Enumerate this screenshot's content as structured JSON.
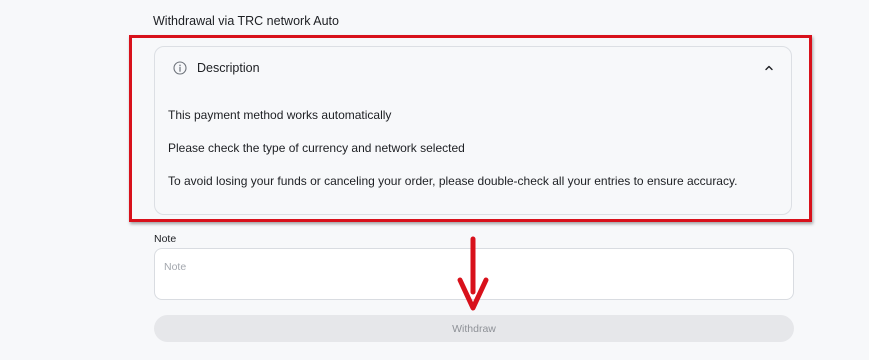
{
  "section": {
    "title": "Withdrawal via TRC network Auto"
  },
  "description": {
    "title": "Description",
    "icon": "info-icon",
    "toggle_icon": "chevron-up-icon",
    "lines": [
      "This payment method works automatically",
      "Please check the type of currency and network selected",
      "To avoid losing your funds or canceling your order, please double-check all your entries to ensure accuracy."
    ]
  },
  "note": {
    "label": "Note",
    "placeholder": "Note",
    "value": ""
  },
  "actions": {
    "withdraw_label": "Withdraw"
  },
  "annotation": {
    "highlight_color": "#d8111b",
    "arrow_color": "#d8111b",
    "arrow_icon": "arrow-down-icon"
  }
}
